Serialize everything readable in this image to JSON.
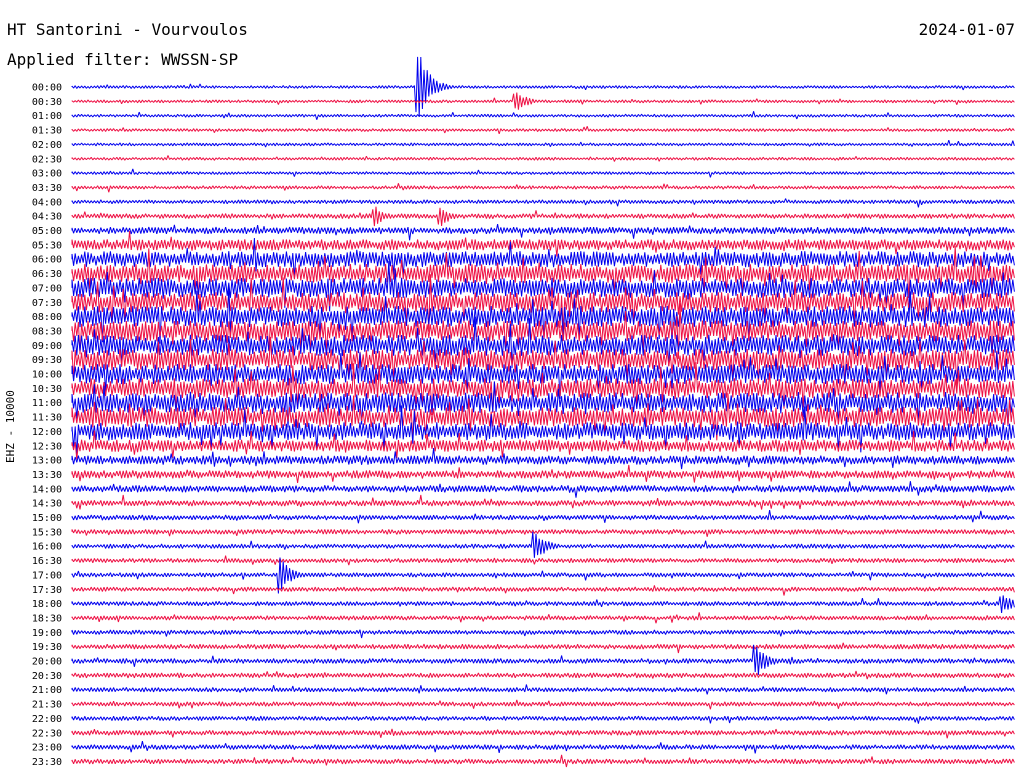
{
  "header": {
    "station": "HT Santorini - Vourvoulos",
    "date": "2024-01-07",
    "filter": "Applied filter: WWSSN-SP"
  },
  "chart_data": {
    "type": "helicorder",
    "channel_label": "EHZ - 10000",
    "row_labels": [
      "00:00",
      "00:30",
      "01:00",
      "01:30",
      "02:00",
      "02:30",
      "03:00",
      "03:30",
      "04:00",
      "04:30",
      "05:00",
      "05:30",
      "06:00",
      "06:30",
      "07:00",
      "07:30",
      "08:00",
      "08:30",
      "09:00",
      "09:30",
      "10:00",
      "10:30",
      "11:00",
      "11:30",
      "12:00",
      "12:30",
      "13:00",
      "13:30",
      "14:00",
      "14:30",
      "15:00",
      "15:30",
      "16:00",
      "16:30",
      "17:00",
      "17:30",
      "18:00",
      "18:30",
      "19:00",
      "19:30",
      "20:00",
      "20:30",
      "21:00",
      "21:30",
      "22:00",
      "22:30",
      "23:00",
      "23:30"
    ],
    "series_colors": [
      "#0000ee",
      "#ee1144"
    ],
    "relative_amplitude": [
      0.3,
      0.3,
      0.3,
      0.3,
      0.3,
      0.3,
      0.3,
      0.35,
      0.4,
      0.5,
      0.7,
      1.1,
      1.6,
      1.9,
      2.0,
      2.0,
      2.1,
      2.1,
      2.1,
      2.1,
      2.0,
      2.0,
      2.0,
      2.0,
      1.8,
      1.2,
      0.9,
      0.8,
      0.7,
      0.6,
      0.5,
      0.5,
      0.45,
      0.45,
      0.45,
      0.45,
      0.45,
      0.45,
      0.45,
      0.5,
      0.5,
      0.5,
      0.45,
      0.45,
      0.45,
      0.5,
      0.5,
      0.5
    ],
    "events": [
      {
        "row": 0,
        "x_fraction": 0.367,
        "amplitude": 3.0
      },
      {
        "row": 1,
        "x_fraction": 0.47,
        "amplitude": 0.9
      },
      {
        "row": 9,
        "x_fraction": 0.32,
        "amplitude": 0.9
      },
      {
        "row": 9,
        "x_fraction": 0.39,
        "amplitude": 0.9
      },
      {
        "row": 32,
        "x_fraction": 0.49,
        "amplitude": 1.4
      },
      {
        "row": 34,
        "x_fraction": 0.22,
        "amplitude": 1.5
      },
      {
        "row": 40,
        "x_fraction": 0.725,
        "amplitude": 1.4
      },
      {
        "row": 36,
        "x_fraction": 0.985,
        "amplitude": 0.9
      }
    ]
  }
}
